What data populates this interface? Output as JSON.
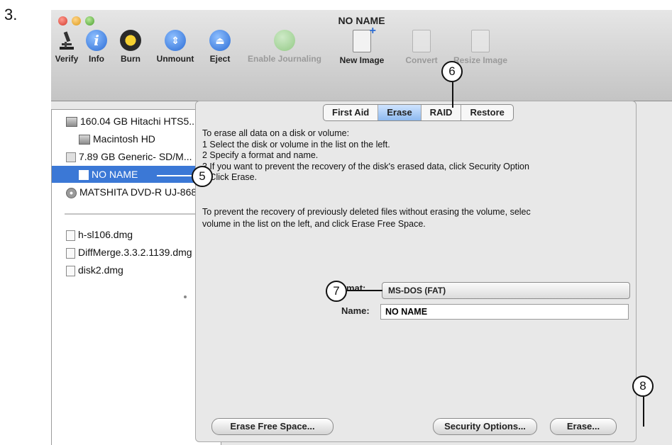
{
  "step_number": "3.",
  "window": {
    "title": "NO NAME"
  },
  "toolbar": {
    "items": [
      {
        "label": "Verify",
        "icon": "microscope-icon",
        "enabled": true
      },
      {
        "label": "Info",
        "icon": "info-icon",
        "enabled": true
      },
      {
        "label": "Burn",
        "icon": "burn-icon",
        "enabled": true
      },
      {
        "label": "Unmount",
        "icon": "unmount-icon",
        "enabled": true
      },
      {
        "label": "Eject",
        "icon": "eject-icon",
        "enabled": true
      },
      {
        "label": "Enable Journaling",
        "icon": "journaling-icon",
        "enabled": false
      },
      {
        "label": "New Image",
        "icon": "new-image-icon",
        "enabled": true
      },
      {
        "label": "Convert",
        "icon": "convert-icon",
        "enabled": false
      },
      {
        "label": "Resize Image",
        "icon": "resize-image-icon",
        "enabled": false
      }
    ]
  },
  "sidebar": {
    "items": [
      {
        "label": "160.04 GB Hitachi HTS5...",
        "kind": "disk"
      },
      {
        "label": "Macintosh HD",
        "kind": "volume"
      },
      {
        "label": "7.89 GB Generic- SD/M...",
        "kind": "disk"
      },
      {
        "label": "NO NAME",
        "kind": "volume",
        "selected": true
      },
      {
        "label": "MATSHITA DVD-R UJ-868",
        "kind": "dvd"
      },
      {
        "label": "h-sl106.dmg",
        "kind": "dmg"
      },
      {
        "label": "DiffMerge.3.3.2.1139.dmg",
        "kind": "dmg"
      },
      {
        "label": "disk2.dmg",
        "kind": "dmg"
      }
    ]
  },
  "tabs": [
    {
      "label": "First Aid",
      "active": false
    },
    {
      "label": "Erase",
      "active": true
    },
    {
      "label": "RAID",
      "active": false
    },
    {
      "label": "Restore",
      "active": false
    }
  ],
  "erase": {
    "instructions": [
      "To erase all data on a disk or volume:",
      "1 Select the disk or volume in the list on the left.",
      "2 Specify a format and name.",
      "3 If you want to prevent the recovery of the disk's erased data, click Security Option",
      "4 Click Erase."
    ],
    "free_space_note": [
      "To prevent the recovery of previously deleted files without erasing the volume, selec",
      "volume in the list on the left, and click Erase Free Space."
    ],
    "format_label": "Format:",
    "format_value": "MS-DOS (FAT)",
    "name_label": "Name:",
    "name_value": "NO NAME",
    "buttons": {
      "erase_free_space": "Erase Free Space...",
      "security_options": "Security Options...",
      "erase": "Erase..."
    }
  },
  "callouts": [
    "5",
    "6",
    "7",
    "8"
  ],
  "colors": {
    "selection": "#3b78d6",
    "active_tab": "#8db9ef"
  }
}
